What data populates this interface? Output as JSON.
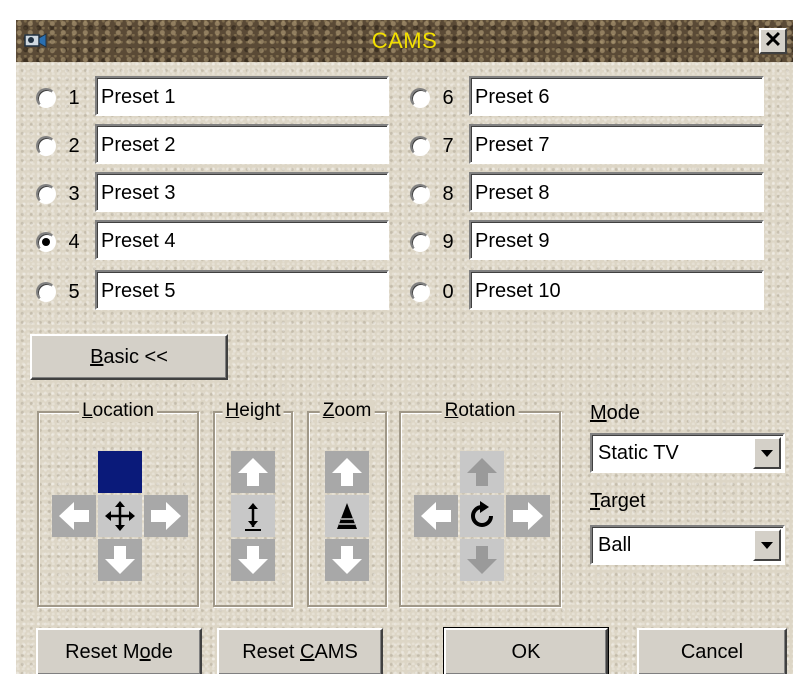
{
  "window": {
    "title": "CAMS",
    "close_label": "✕"
  },
  "presets": [
    {
      "number": "1",
      "value": "Preset 1",
      "checked": false
    },
    {
      "number": "2",
      "value": "Preset 2",
      "checked": false
    },
    {
      "number": "3",
      "value": "Preset 3",
      "checked": false
    },
    {
      "number": "4",
      "value": "Preset 4",
      "checked": true
    },
    {
      "number": "5",
      "value": "Preset 5",
      "checked": false
    },
    {
      "number": "6",
      "value": "Preset 6",
      "checked": false
    },
    {
      "number": "7",
      "value": "Preset 7",
      "checked": false
    },
    {
      "number": "8",
      "value": "Preset 8",
      "checked": false
    },
    {
      "number": "9",
      "value": "Preset 9",
      "checked": false
    },
    {
      "number": "0",
      "value": "Preset 10",
      "checked": false
    }
  ],
  "basic_button": {
    "mnemonic": "B",
    "rest": "asic <<"
  },
  "groups": {
    "location": {
      "mnemonic": "L",
      "rest": "ocation"
    },
    "height": {
      "mnemonic": "H",
      "rest": "eight"
    },
    "zoom": {
      "mnemonic": "Z",
      "rest": "oom"
    },
    "rotation": {
      "mnemonic": "R",
      "rest": "otation"
    }
  },
  "mode": {
    "label_mnemonic": "M",
    "label_rest": "ode",
    "selected": "Static TV"
  },
  "target": {
    "label_mnemonic": "T",
    "label_rest": "arget",
    "selected": "Ball"
  },
  "buttons": {
    "reset_mode_pre": "Reset M",
    "reset_mode_mnemonic": "o",
    "reset_mode_post": "de",
    "reset_cams_pre": "Reset ",
    "reset_cams_mnemonic": "C",
    "reset_cams_post": "AMS",
    "ok": "OK",
    "cancel": "Cancel"
  },
  "colors": {
    "title_text": "#f3e000",
    "active_arrow": "#0a1a7a",
    "window_bg": "#ddd6c6"
  }
}
